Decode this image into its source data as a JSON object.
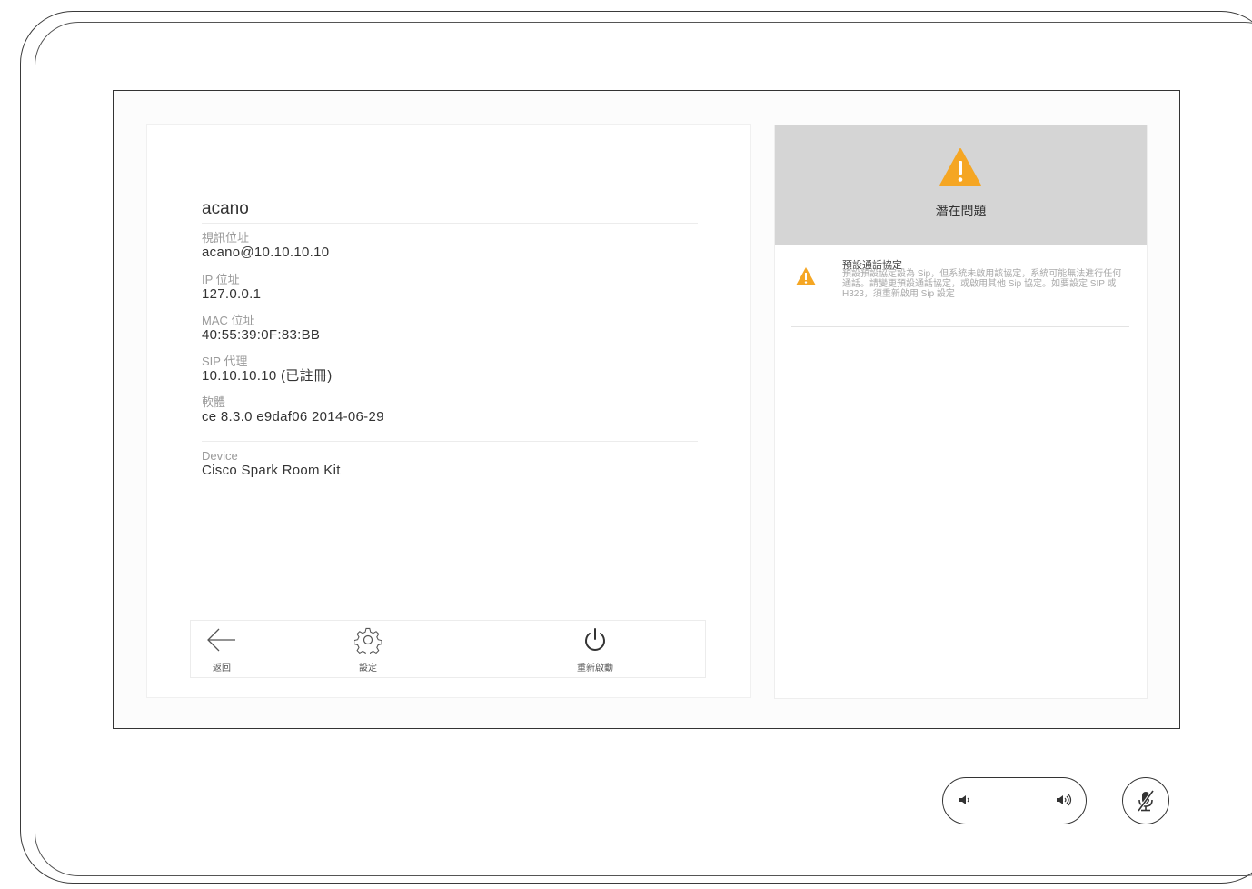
{
  "device": {
    "name": "acano",
    "fields": [
      {
        "label": "視訊位址",
        "value": "acano@10.10.10.10"
      },
      {
        "label": "IP 位址",
        "value": "127.0.0.1"
      },
      {
        "label": "MAC 位址",
        "value": "40:55:39:0F:83:BB"
      },
      {
        "label": "SIP 代理",
        "value": "10.10.10.10 (已註冊)"
      },
      {
        "label": "軟體",
        "value": "ce 8.3.0 e9daf06 2014-06-29"
      }
    ],
    "device_label": "Device",
    "device_value": "Cisco Spark Room Kit"
  },
  "toolbar": {
    "back_label": "返回",
    "settings_label": "設定",
    "restart_label": "重新啟動"
  },
  "issues_panel": {
    "title": "潛在問題",
    "issues": [
      {
        "title": "預設通話協定",
        "description": "預設預設協定設為 Sip，但系統未啟用該協定，系統可能無法進行任何通話。請變更預設通話協定，或啟用其他 Sip 協定。如要設定 SIP 或 H323，須重新啟用 Sip 設定"
      }
    ]
  },
  "colors": {
    "warning": "#f5a623",
    "header_bg": "#d5d5d5"
  },
  "icons": [
    "back-arrow-icon",
    "gear-icon",
    "power-icon",
    "warning-icon",
    "volume-down-icon",
    "volume-up-icon",
    "microphone-muted-icon"
  ]
}
